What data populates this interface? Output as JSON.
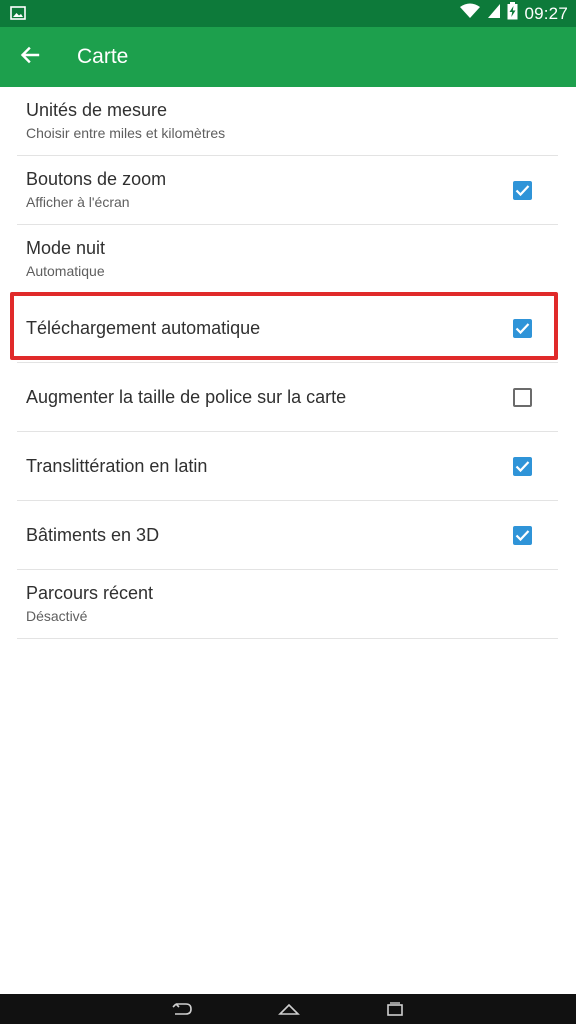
{
  "status_bar": {
    "time": "09:27",
    "icons": [
      "image-icon",
      "wifi-icon",
      "signal-icon",
      "battery-charging-icon"
    ]
  },
  "app_bar": {
    "title": "Carte",
    "back_icon": "arrow-back-icon"
  },
  "settings": [
    {
      "title": "Unités de mesure",
      "subtitle": "Choisir entre miles et kilomètres",
      "checkbox": null
    },
    {
      "title": "Boutons de zoom",
      "subtitle": "Afficher à l'écran",
      "checkbox": true
    },
    {
      "title": "Mode nuit",
      "subtitle": "Automatique",
      "checkbox": null
    },
    {
      "title": "Téléchargement automatique",
      "subtitle": "",
      "checkbox": true
    },
    {
      "title": "Augmenter la taille de police sur la carte",
      "subtitle": "",
      "checkbox": false
    },
    {
      "title": "Translittération en latin",
      "subtitle": "",
      "checkbox": true
    },
    {
      "title": "Bâtiments en 3D",
      "subtitle": "",
      "checkbox": true
    },
    {
      "title": "Parcours récent",
      "subtitle": "Désactivé",
      "checkbox": null
    }
  ],
  "nav_bar": {
    "icons": [
      "nav-back-icon",
      "nav-home-icon",
      "nav-recents-icon"
    ]
  },
  "colors": {
    "status_bar": "#0d7a3a",
    "app_bar": "#1da04d",
    "checkbox_checked": "#2f94d8",
    "highlight": "#e02a2a"
  }
}
